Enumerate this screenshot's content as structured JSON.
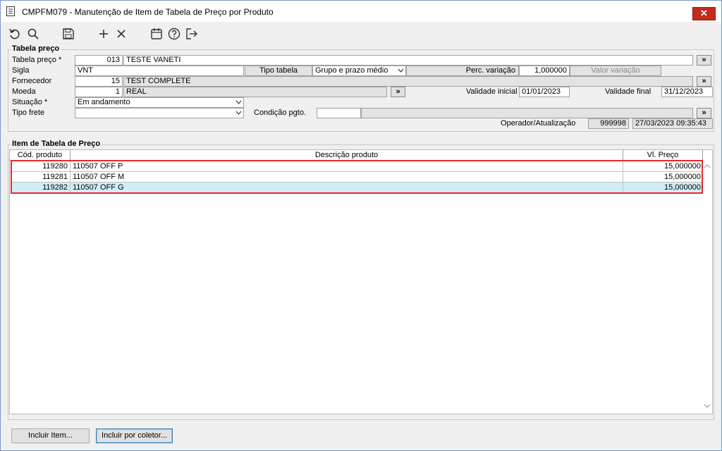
{
  "window": {
    "title": "CMPFM079 - Manutenção de Item de Tabela de Preço por Produto",
    "close_label": "✕"
  },
  "toolbar": {
    "icons": [
      "undo-icon",
      "search-icon",
      "save-icon",
      "add-icon",
      "delete-icon",
      "calendar-icon",
      "help-icon",
      "exit-icon"
    ]
  },
  "header_group": {
    "title": "Tabela preço",
    "tabela_preco": {
      "label": "Tabela preço *",
      "code": "013",
      "name": "TESTE VANETI"
    },
    "sigla": {
      "label": "Sigla",
      "value": "VNT"
    },
    "tipo_tabela": {
      "label": "Tipo tabela",
      "value": "Grupo e prazo médio"
    },
    "perc_variacao": {
      "label": "Perc. variação",
      "value": "1,000000"
    },
    "valor_variacao": {
      "placeholder": "Valor variação"
    },
    "fornecedor": {
      "label": "Fornecedor",
      "code": "15",
      "name": "TEST COMPLETE"
    },
    "moeda": {
      "label": "Moeda",
      "code": "1",
      "name": "REAL"
    },
    "validade_inicial": {
      "label": "Validade inicial",
      "value": "01/01/2023"
    },
    "validade_final": {
      "label": "Validade final",
      "value": "31/12/2023"
    },
    "situacao": {
      "label": "Situação *",
      "value": "Em andamento"
    },
    "tipo_frete": {
      "label": "Tipo frete",
      "value": ""
    },
    "condicao_pgto": {
      "label": "Condição pgto.",
      "code": "",
      "name": ""
    },
    "operador": {
      "label": "Operador/Atualização",
      "code": "999998",
      "datetime": "27/03/2023 09:35:43"
    },
    "lookup_label": "»"
  },
  "items_group": {
    "title": "Item de Tabela de Preço",
    "columns": [
      "Cód. produto",
      "Descrição produto",
      "Vl. Preço"
    ],
    "rows": [
      {
        "code": "119280",
        "desc": "110507 OFF P",
        "price": "15,000000"
      },
      {
        "code": "119281",
        "desc": "110507 OFF M",
        "price": "15,000000"
      },
      {
        "code": "119282",
        "desc": "110507 OFF G",
        "price": "15,000000"
      }
    ]
  },
  "footer": {
    "incluir_item": "Incluir Item...",
    "incluir_coletor": "Incluir por coletor..."
  }
}
